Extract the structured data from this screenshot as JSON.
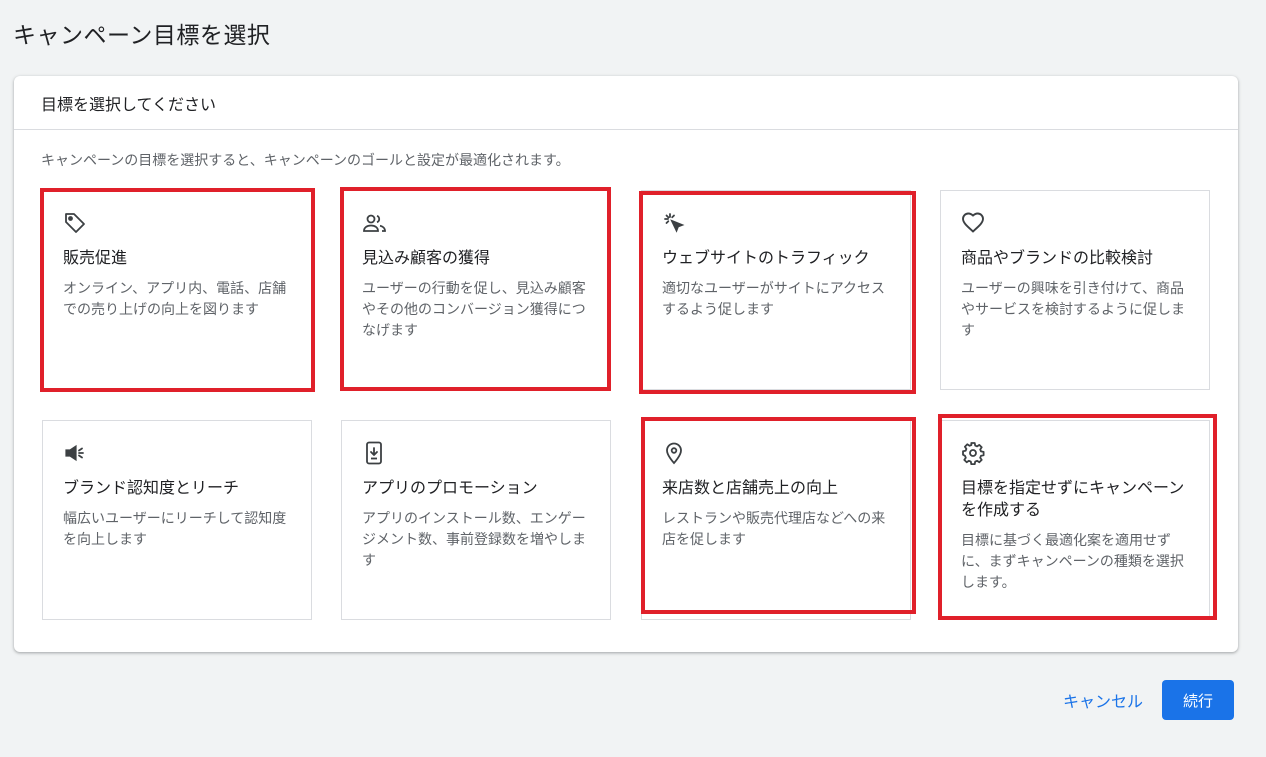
{
  "page": {
    "title": "キャンペーン目標を選択"
  },
  "card": {
    "header": "目標を選択してください",
    "description": "キャンペーンの目標を選択すると、キャンペーンのゴールと設定が最適化されます。"
  },
  "tiles": [
    {
      "icon": "tag-icon",
      "title": "販売促進",
      "description": "オンライン、アプリ内、電話、店舗での売り上げの向上を図ります",
      "highlighted": true
    },
    {
      "icon": "people-icon",
      "title": "見込み顧客の獲得",
      "description": "ユーザーの行動を促し、見込み顧客やその他のコンバージョン獲得につなげます",
      "highlighted": true
    },
    {
      "icon": "cursor-click-icon",
      "title": "ウェブサイトのトラフィック",
      "description": "適切なユーザーがサイトにアクセスするよう促します",
      "highlighted": true
    },
    {
      "icon": "heart-icon",
      "title": "商品やブランドの比較検討",
      "description": "ユーザーの興味を引き付けて、商品やサービスを検討するように促します",
      "highlighted": false
    },
    {
      "icon": "megaphone-icon",
      "title": "ブランド認知度とリーチ",
      "description": "幅広いユーザーにリーチして認知度を向上します",
      "highlighted": false
    },
    {
      "icon": "mobile-download-icon",
      "title": "アプリのプロモーション",
      "description": "アプリのインストール数、エンゲージメント数、事前登録数を増やします",
      "highlighted": false
    },
    {
      "icon": "location-pin-icon",
      "title": "来店数と店舗売上の向上",
      "description": "レストランや販売代理店などへの来店を促します",
      "highlighted": true
    },
    {
      "icon": "gear-icon",
      "title": "目標を指定せずにキャンペーンを作成する",
      "description": "目標に基づく最適化案を適用せずに、まずキャンペーンの種類を選択します。",
      "highlighted": true
    }
  ],
  "footer": {
    "cancel_label": "キャンセル",
    "continue_label": "続行"
  },
  "colors": {
    "accent": "#1a73e8",
    "highlight": "#e0202a",
    "background": "#f1f3f4"
  }
}
